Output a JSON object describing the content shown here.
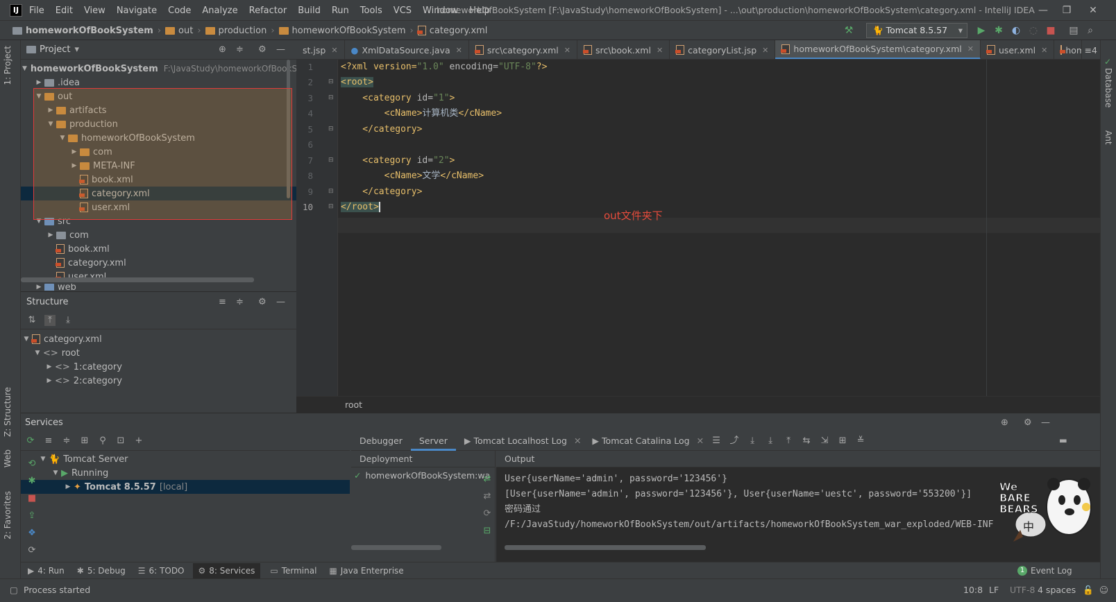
{
  "app": {
    "window_title": "homeworkOfBookSystem [F:\\JavaStudy\\homeworkOfBookSystem] - ...\\out\\production\\homeworkOfBookSystem\\category.xml - IntelliJ IDEA",
    "icon_label": "IJ"
  },
  "menu": [
    "File",
    "Edit",
    "View",
    "Navigate",
    "Code",
    "Analyze",
    "Refactor",
    "Build",
    "Run",
    "Tools",
    "VCS",
    "Window",
    "Help"
  ],
  "breadcrumb": [
    "homeworkOfBookSystem",
    "out",
    "production",
    "homeworkOfBookSystem",
    "category.xml"
  ],
  "run_config": "Tomcat 8.5.57",
  "left_strip": {
    "project": "1: Project",
    "structure": "Z: Structure",
    "web": "Web",
    "favorites": "2: Favorites"
  },
  "right_strip": {
    "database": "Database",
    "ant": "Ant"
  },
  "project_panel": {
    "title": "Project",
    "tree": [
      {
        "label": "homeworkOfBookSystem",
        "path": "F:\\JavaStudy\\homeworkOfBookSy"
      },
      {
        "label": ".idea"
      },
      {
        "label": "out"
      },
      {
        "label": "artifacts"
      },
      {
        "label": "production"
      },
      {
        "label": "homeworkOfBookSystem"
      },
      {
        "label": "com"
      },
      {
        "label": "META-INF"
      },
      {
        "label": "book.xml"
      },
      {
        "label": "category.xml"
      },
      {
        "label": "user.xml"
      },
      {
        "label": "src"
      },
      {
        "label": "com"
      },
      {
        "label": "book.xml"
      },
      {
        "label": "category.xml"
      },
      {
        "label": "user.xml"
      },
      {
        "label": "web"
      }
    ]
  },
  "structure_panel": {
    "title": "Structure",
    "tree": [
      {
        "label": "category.xml"
      },
      {
        "label": "root"
      },
      {
        "label": "1:category"
      },
      {
        "label": "2:category"
      }
    ]
  },
  "editor": {
    "tabs": [
      {
        "label": "st.jsp"
      },
      {
        "label": "XmlDataSource.java"
      },
      {
        "label": "src\\category.xml"
      },
      {
        "label": "src\\book.xml"
      },
      {
        "label": "categoryList.jsp"
      },
      {
        "label": "homeworkOfBookSystem\\category.xml"
      },
      {
        "label": "user.xml"
      },
      {
        "label": "homeworkO"
      }
    ],
    "tab_count": "≡4",
    "line_numbers": [
      "1",
      "2",
      "3",
      "4",
      "5",
      "6",
      "7",
      "8",
      "9",
      "10"
    ],
    "code": {
      "l1": {
        "a": "<?xml version=",
        "b": "\"1.0\"",
        "c": " encoding=",
        "d": "\"UTF-8\"",
        "e": "?>"
      },
      "l2": "<root>",
      "l3": {
        "a": "    <category ",
        "b": "id=",
        "c": "\"1\"",
        "d": ">"
      },
      "l4": {
        "a": "        <cName>",
        "b": "计算机类",
        "c": "</cName>"
      },
      "l5": "    </category>",
      "l7": {
        "a": "    <category ",
        "b": "id=",
        "c": "\"2\"",
        "d": ">"
      },
      "l8": {
        "a": "        <cName>",
        "b": "文学",
        "c": "</cName>"
      },
      "l9": "    </category>",
      "l10": "</root>"
    },
    "footer_breadcrumb": "root",
    "annotation": "out文件夹下"
  },
  "services": {
    "title": "Services",
    "tree": [
      {
        "label": "Tomcat Server"
      },
      {
        "label": "Running"
      },
      {
        "label": "Tomcat 8.5.57",
        "suffix": "[local]"
      }
    ],
    "tabs": [
      "Debugger",
      "Server",
      "Tomcat Localhost Log",
      "Tomcat Catalina Log"
    ],
    "deployment_header": "Deployment",
    "output_header": "Output",
    "deployment_item": "homeworkOfBookSystem:wa",
    "output_lines": [
      "User{userName='admin', password='123456'}",
      "[User{userName='admin', password='123456'}, User{userName='uestc', password='553200'}]",
      "密码通过",
      "/F:/JavaStudy/homeworkOfBookSystem/out/artifacts/homeworkOfBookSystem_war_exploded/WEB-INF"
    ]
  },
  "bottom_tabs": [
    "4: Run",
    "5: Debug",
    "6: TODO",
    "8: Services",
    "Terminal",
    "Java Enterprise"
  ],
  "event_log": {
    "count": "1",
    "label": "Event Log"
  },
  "status": {
    "message": "Process started",
    "position": "10:8",
    "line_sep": "LF",
    "encoding": "UTF-8",
    "indent": "4 spaces"
  },
  "sticker": {
    "brand": "We BARE BEARS",
    "char": "中"
  },
  "colors": {
    "accent": "#4a88c7",
    "selection": "#0d293e",
    "annotation": "#e74c3c",
    "folder": "#c98b3f",
    "run_green": "#59a869",
    "stop_red": "#c75450"
  }
}
